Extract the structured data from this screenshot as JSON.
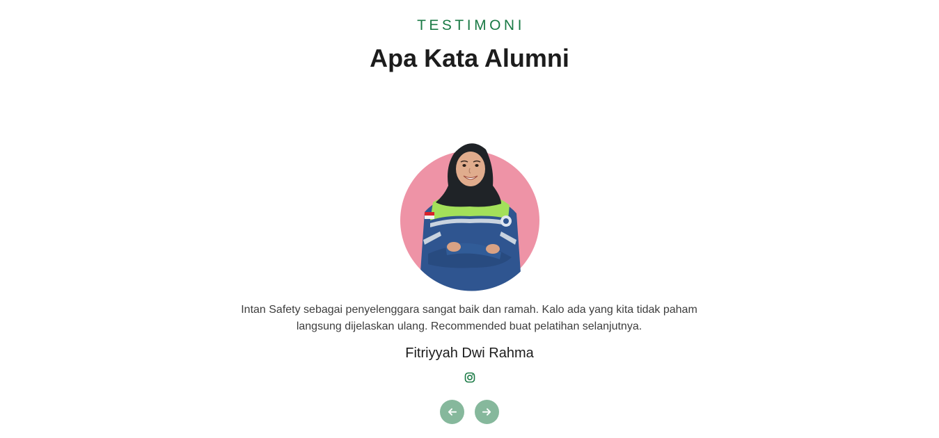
{
  "section": {
    "eyebrow": "TESTIMONI",
    "title": "Apa Kata Alumni"
  },
  "testimonial": {
    "quote": "Intan Safety sebagai penyelenggara sangat baik dan ramah. Kalo ada yang kita tidak paham langsung dijelaskan ulang. Recommended buat pelatihan selanjutnya.",
    "name": "Fitriyyah Dwi Rahma",
    "social_icon": "instagram-icon"
  },
  "navigation": {
    "prev_icon": "arrow-left-icon",
    "next_icon": "arrow-right-icon"
  },
  "colors": {
    "accent": "#1a7a45",
    "nav_button": "#86b89c",
    "avatar_bg": "#ee93a6"
  }
}
